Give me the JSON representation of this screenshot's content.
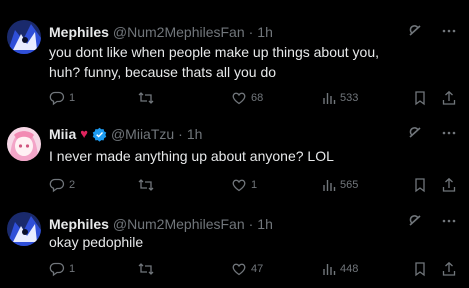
{
  "tweets": [
    {
      "name": "Mephiles",
      "handle": "@Num2MephilesFan",
      "dot": "·",
      "time": "1h",
      "text": "you dont like when people make up things about you, huh? funny, because thats all you do",
      "replies": "1",
      "reposts": "",
      "likes": "68",
      "views": "533"
    },
    {
      "name": "Miia",
      "heart": "♥",
      "handle": "@MiiaTzu",
      "dot": "·",
      "time": "1h",
      "text": "I never made anything up about anyone? LOL",
      "replies": "2",
      "reposts": "",
      "likes": "1",
      "views": "565"
    },
    {
      "name": "Mephiles",
      "handle": "@Num2MephilesFan",
      "dot": "·",
      "time": "1h",
      "text": "okay pedophile",
      "replies": "1",
      "reposts": "",
      "likes": "47",
      "views": "448"
    }
  ],
  "colors": {
    "background": "#000000",
    "text_primary": "#e7e9ea",
    "text_secondary": "#71767b",
    "verified": "#1d9bf0",
    "heart": "#e0245e"
  },
  "icons": [
    "grok-icon",
    "more-icon",
    "reply-icon",
    "repost-icon",
    "like-icon",
    "views-icon",
    "bookmark-icon",
    "share-icon"
  ]
}
